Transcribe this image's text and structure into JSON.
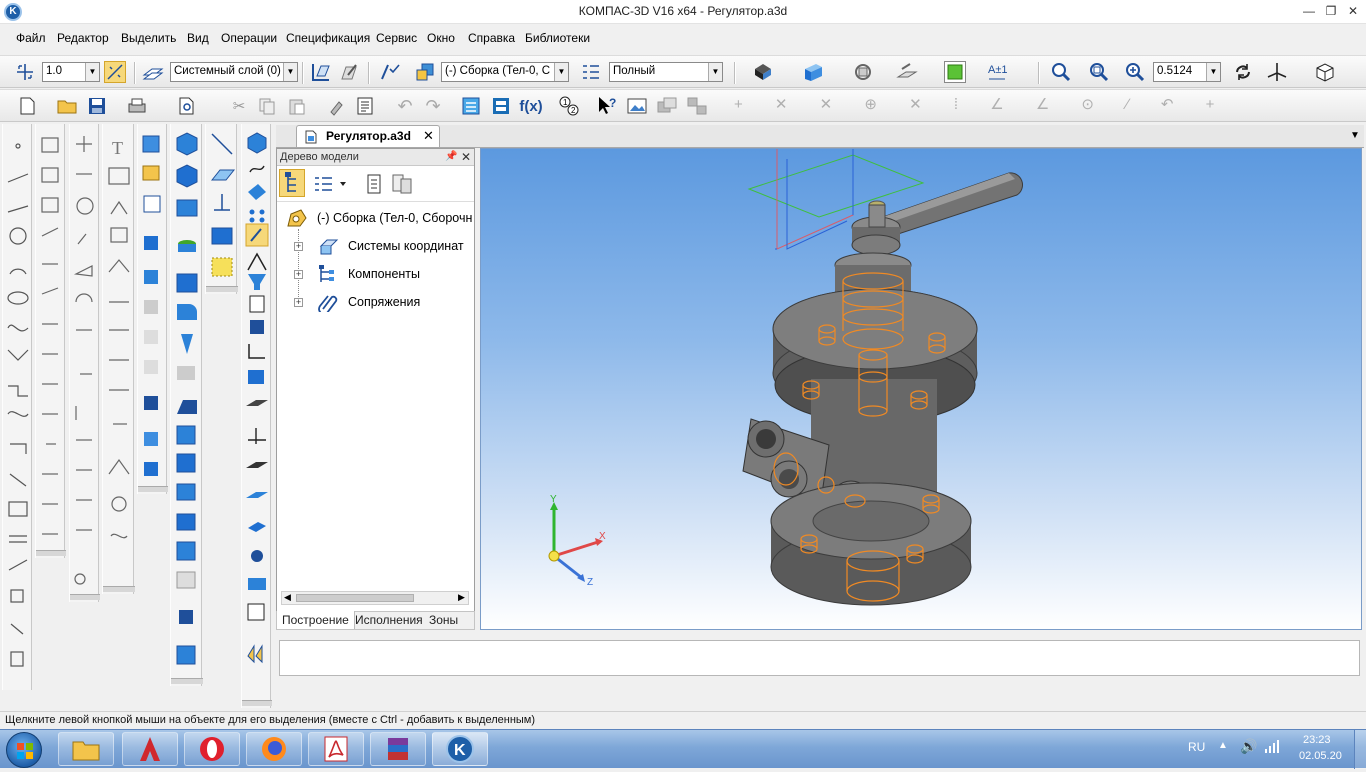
{
  "app": {
    "title": "КОМПАС-3D V16  x64 - Регулятор.a3d",
    "icon_letter": "K"
  },
  "window_controls": [
    "minimize-icon",
    "restore-icon",
    "close-icon"
  ],
  "menu": [
    "Файл",
    "Редактор",
    "Выделить",
    "Вид",
    "Операции",
    "Спецификация",
    "Сервис",
    "Окно",
    "Справка",
    "Библиотеки"
  ],
  "toolbar1": {
    "step_value": "1.0",
    "layer_value": "Системный слой (0)",
    "assembly_value": "(-) Сборка (Тел-0, С",
    "render_mode_value": "Полный",
    "zoom_value": "0.5124"
  },
  "document_tab": {
    "title": "Регулятор.a3d"
  },
  "tree": {
    "header": "Дерево модели",
    "root": "(-) Сборка (Тел-0, Сборочн",
    "items": [
      "Системы координат",
      "Компоненты",
      "Сопряжения"
    ],
    "tabs": [
      "Построение",
      "Исполнения",
      "Зоны"
    ]
  },
  "axes": {
    "x": "X",
    "y": "Y",
    "z": "Z"
  },
  "status": {
    "message": "Щелкните левой кнопкой мыши на объекте для его выделения (вместе с Ctrl - добавить к выделенным)"
  },
  "taskbar": {
    "apps": [
      "explorer-icon",
      "autocad-icon",
      "opera-icon",
      "firefox-icon",
      "acrobat-icon",
      "winrar-icon",
      "kompas-icon"
    ],
    "language": "RU",
    "time": "23:23",
    "date": "02.05.20"
  },
  "colors": {
    "accent": "#1f4f9a",
    "viewport_top": "#5c99df",
    "model_gray": "#6e6e6e",
    "hidden_lines": "#f08a24"
  }
}
